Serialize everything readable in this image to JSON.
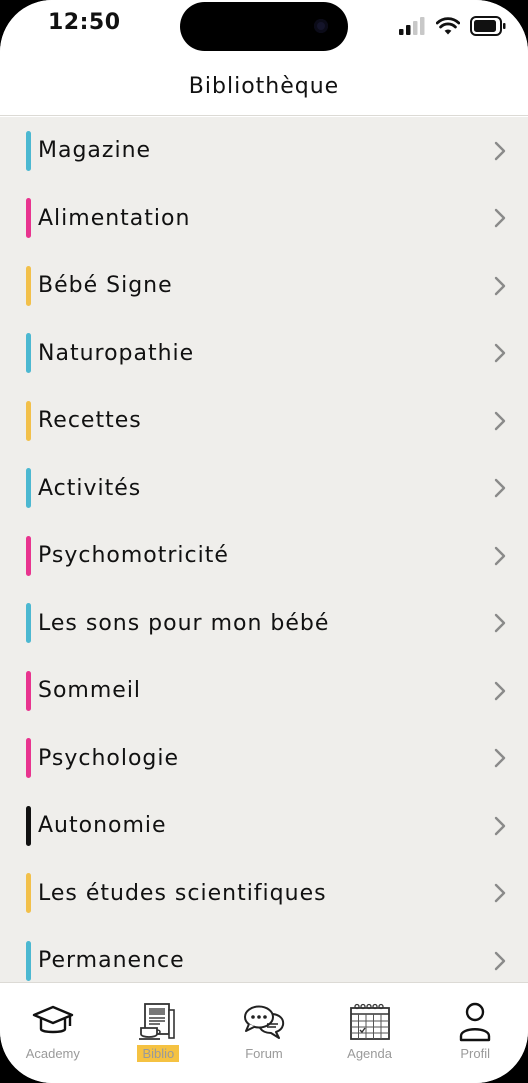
{
  "status": {
    "time": "12:50"
  },
  "header": {
    "title": "Bibliothèque"
  },
  "colors": {
    "blue": "#4cb8d1",
    "pink": "#e8348f",
    "yellow": "#f2c04a",
    "black": "#111111",
    "active_tab_highlight": "#f5c242"
  },
  "categories": [
    {
      "label": "Magazine",
      "color": "#4cb8d1"
    },
    {
      "label": "Alimentation",
      "color": "#e8348f"
    },
    {
      "label": "Bébé Signe",
      "color": "#f2c04a"
    },
    {
      "label": "Naturopathie",
      "color": "#4cb8d1"
    },
    {
      "label": "Recettes",
      "color": "#f2c04a"
    },
    {
      "label": "Activités",
      "color": "#4cb8d1"
    },
    {
      "label": "Psychomotricité",
      "color": "#e8348f"
    },
    {
      "label": "Les sons pour mon bébé",
      "color": "#4cb8d1"
    },
    {
      "label": "Sommeil",
      "color": "#e8348f"
    },
    {
      "label": "Psychologie",
      "color": "#e8348f"
    },
    {
      "label": "Autonomie",
      "color": "#111111"
    },
    {
      "label": "Les études scientifiques",
      "color": "#f2c04a"
    },
    {
      "label": "Permanence",
      "color": "#4cb8d1"
    }
  ],
  "tabs": [
    {
      "label": "Academy",
      "icon": "graduation-cap-icon",
      "active": false
    },
    {
      "label": "Biblio",
      "icon": "library-icon",
      "active": true
    },
    {
      "label": "Forum",
      "icon": "chat-bubbles-icon",
      "active": false
    },
    {
      "label": "Agenda",
      "icon": "calendar-icon",
      "active": false
    },
    {
      "label": "Profil",
      "icon": "user-icon",
      "active": false
    }
  ]
}
